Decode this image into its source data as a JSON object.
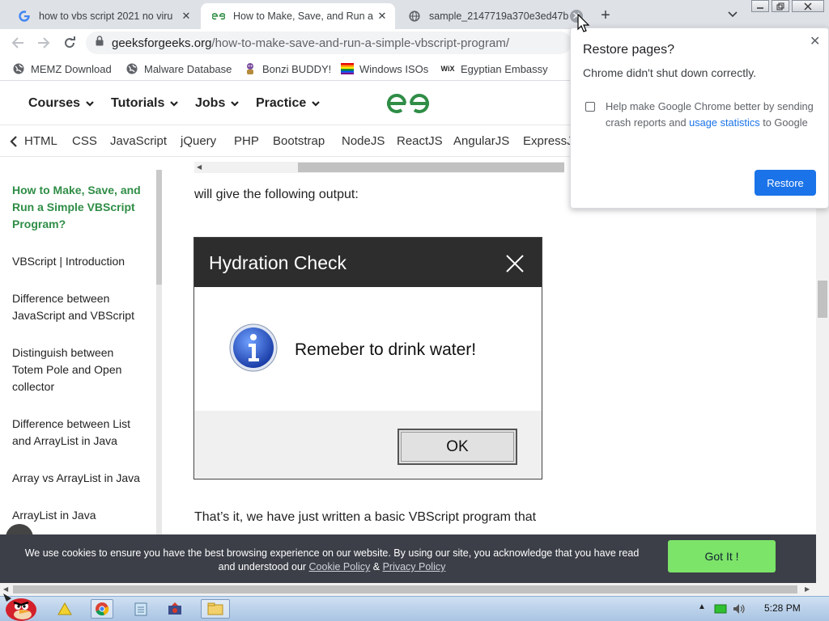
{
  "browser": {
    "tabs": [
      {
        "title": "how to vbs script 2021 no viru",
        "active": false
      },
      {
        "title": "How to Make, Save, and Run a",
        "active": true
      },
      {
        "title": "sample_2147719a370e3ed47b",
        "active": false
      }
    ],
    "close_symbol": "✕",
    "new_tab_symbol": "+",
    "url_domain": "geeksforgeeks.org",
    "url_path": "/how-to-make-save-and-run-a-simple-vbscript-program/",
    "bookmarks": [
      {
        "label": "MEMZ Download",
        "icon": "globe-icon"
      },
      {
        "label": "Malware Database",
        "icon": "globe-icon"
      },
      {
        "label": "Bonzi BUDDY!",
        "icon": "bonzi-icon"
      },
      {
        "label": "Windows ISOs",
        "icon": "rainbow-flag-icon"
      },
      {
        "label": "Egyptian Embassy",
        "icon": "wix-icon"
      }
    ]
  },
  "site": {
    "top_nav": [
      "Courses",
      "Tutorials",
      "Jobs",
      "Practice"
    ],
    "sub_nav": [
      "HTML",
      "CSS",
      "JavaScript",
      "jQuery",
      "PHP",
      "Bootstrap",
      "NodeJS",
      "ReactJS",
      "AngularJS",
      "ExpressJ"
    ],
    "sidebar": [
      "How to Make, Save, and Run a Simple VBScript Program?",
      "VBScript | Introduction",
      "Difference between JavaScript and VBScript",
      "Distinguish between Totem Pole and Open collector",
      "Difference between List and ArrayList in Java",
      "Array vs ArrayList in Java",
      "ArrayList in Java"
    ],
    "para_top": "will give the following output:",
    "para_bottom": "That’s it, we have just written a basic VBScript program that",
    "accent_color": "#2f8d46"
  },
  "dialog": {
    "title": "Hydration Check",
    "message": "Remeber to drink water!",
    "ok_label": "OK"
  },
  "cookie": {
    "text_before": "We use cookies to ensure you have the best browsing experience on our website. By using our site, you acknowledge that you have read and understood our ",
    "cookie_policy": "Cookie Policy",
    "amp": " & ",
    "privacy_policy": "Privacy Policy",
    "button": "Got It !"
  },
  "restore_popup": {
    "title": "Restore pages?",
    "subtitle": "Chrome didn't shut down correctly.",
    "option_text": "Help make Google Chrome better by sending crash reports and ",
    "option_link": "usage statistics",
    "option_tail": " to Google",
    "button": "Restore",
    "checked": false
  },
  "taskbar": {
    "clock": "5:28 PM",
    "tray_arrow": "▲"
  }
}
